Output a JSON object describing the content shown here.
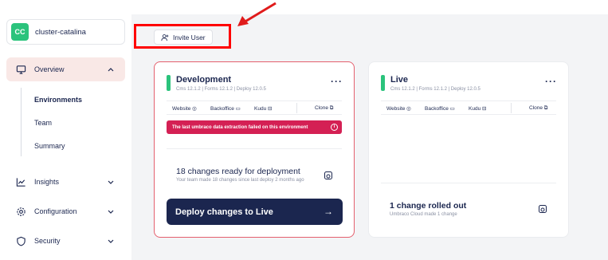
{
  "project": {
    "initials": "CC",
    "name": "cluster-catalina",
    "avatar_color": "#2bc37c"
  },
  "nav": {
    "overview": "Overview",
    "sub_items": [
      "Environments",
      "Team",
      "Summary"
    ],
    "insights": "Insights",
    "configuration": "Configuration",
    "security": "Security"
  },
  "toolbar": {
    "invite_label": "Invite User"
  },
  "environments": [
    {
      "name": "Development",
      "versions": "Cms 12.1.2  |  Forms 12.1.2  |  Deploy 12.0.5",
      "links": {
        "website": "Website",
        "backoffice": "Backoffice",
        "kudu": "Kudu",
        "clone": "Clone"
      },
      "error": "The last umbraco data extraction failed on this environment",
      "changes_title": "18 changes ready for deployment",
      "changes_sub": "Your team made 18 changes since last deploy 2 months ago",
      "deploy_label": "Deploy changes to Live"
    },
    {
      "name": "Live",
      "versions": "Cms 12.1.2  |  Forms 12.1.2  |  Deploy 12.0.5",
      "links": {
        "website": "Website",
        "backoffice": "Backoffice",
        "kudu": "Kudu",
        "clone": "Clone"
      },
      "rolled_title": "1 change rolled out",
      "rolled_sub": "Umbraco Cloud made 1 change"
    }
  ],
  "colors": {
    "accent_red": "#d42054",
    "env_green": "#2bc37c",
    "navy": "#1b264f",
    "active_nav": "#f9e8e6"
  }
}
